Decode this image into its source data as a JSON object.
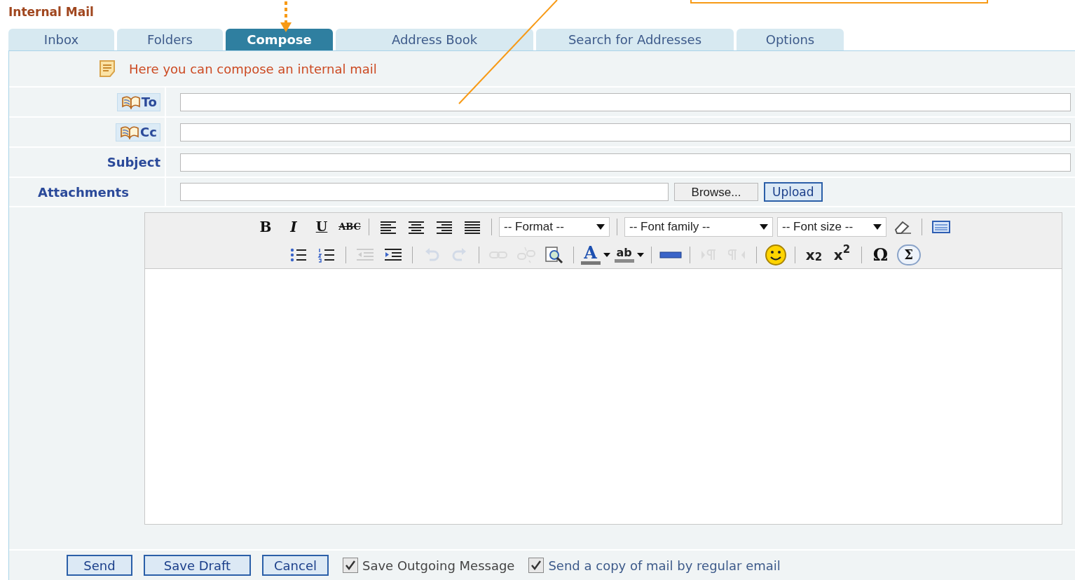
{
  "title": "Internal Mail",
  "tabs": [
    {
      "label": "Inbox",
      "selected": false
    },
    {
      "label": "Folders",
      "selected": false
    },
    {
      "label": "Compose",
      "selected": true
    },
    {
      "label": "Address Book",
      "selected": false
    },
    {
      "label": "Search for Addresses",
      "selected": false
    },
    {
      "label": "Options",
      "selected": false
    }
  ],
  "notice": "Here you can compose an internal mail",
  "fields": [
    {
      "kind": "book",
      "label": "To"
    },
    {
      "kind": "book",
      "label": "Cc"
    },
    {
      "kind": "plain",
      "label": "Subject"
    },
    {
      "kind": "file",
      "label": "Attachments",
      "browse": "Browse...",
      "upload": "Upload"
    }
  ],
  "toolbar": [
    [
      {
        "kind": "glyph",
        "text": "B",
        "disabled": false
      },
      {
        "kind": "glyph",
        "text": "I",
        "disabled": false
      },
      {
        "kind": "glyph",
        "text": "U",
        "disabled": false
      },
      {
        "kind": "glyph",
        "text": "ABC",
        "disabled": false
      },
      {
        "kind": "sep"
      },
      {
        "kind": "icon",
        "disabled": false
      },
      {
        "kind": "icon",
        "disabled": false
      },
      {
        "kind": "icon",
        "disabled": false
      },
      {
        "kind": "icon",
        "disabled": false
      },
      {
        "kind": "sep"
      },
      {
        "kind": "select",
        "value": "-- Format --"
      },
      {
        "kind": "sep"
      },
      {
        "kind": "select",
        "value": "-- Font family --"
      },
      {
        "kind": "select",
        "value": "-- Font size --"
      },
      {
        "kind": "icon",
        "disabled": false
      },
      {
        "kind": "sep"
      },
      {
        "kind": "icon",
        "disabled": false
      }
    ],
    [
      {
        "kind": "icon",
        "disabled": false
      },
      {
        "kind": "icon",
        "disabled": false
      },
      {
        "kind": "sep"
      },
      {
        "kind": "icon",
        "disabled": true
      },
      {
        "kind": "icon",
        "disabled": false
      },
      {
        "kind": "sep"
      },
      {
        "kind": "icon",
        "disabled": true
      },
      {
        "kind": "icon",
        "disabled": true
      },
      {
        "kind": "sep"
      },
      {
        "kind": "icon",
        "disabled": true
      },
      {
        "kind": "icon",
        "disabled": true
      },
      {
        "kind": "icon",
        "disabled": false
      },
      {
        "kind": "sep"
      },
      {
        "kind": "color",
        "text": "A",
        "disabled": false
      },
      {
        "kind": "color",
        "text": "ab",
        "disabled": false
      },
      {
        "kind": "sep"
      },
      {
        "kind": "icon",
        "disabled": false
      },
      {
        "kind": "sep"
      },
      {
        "kind": "icon",
        "disabled": true
      },
      {
        "kind": "icon",
        "disabled": true
      },
      {
        "kind": "sep"
      },
      {
        "kind": "icon",
        "disabled": false
      },
      {
        "kind": "sep"
      },
      {
        "kind": "glyph",
        "text": "x$_{2}$",
        "disabled": false
      },
      {
        "kind": "glyph",
        "text": "x$^{2}$",
        "disabled": false
      },
      {
        "kind": "sep"
      },
      {
        "kind": "glyph",
        "text": "Ω",
        "disabled": false
      },
      {
        "kind": "glyph",
        "text": "Σ",
        "disabled": false
      }
    ]
  ],
  "buttons": [
    "Send",
    "Save Draft",
    "Cancel"
  ],
  "options": [
    {
      "label": "Save Outgoing Message",
      "checked": true
    },
    {
      "label": "Send a copy of mail by regular email",
      "checked": true
    }
  ]
}
